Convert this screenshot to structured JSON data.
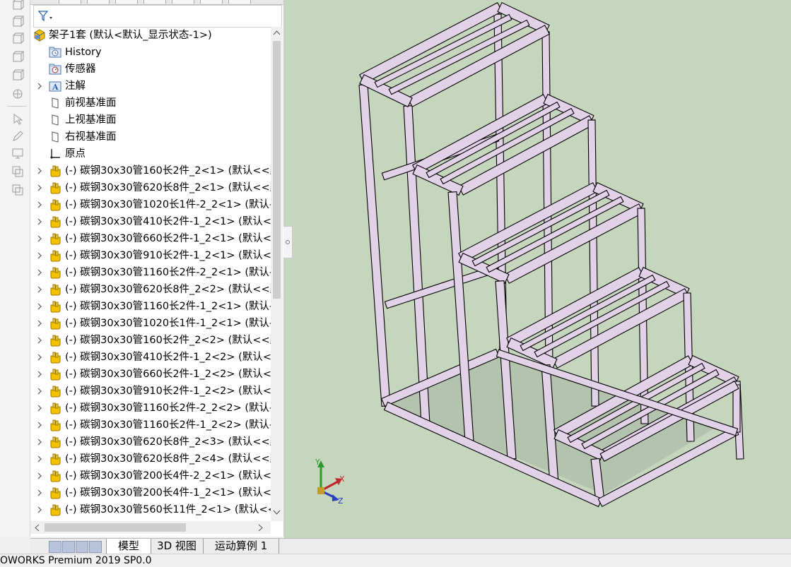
{
  "tree": {
    "root_label": "架子1套  (默认<默认_显示状态-1>)",
    "items": [
      {
        "label": "History",
        "icon": "history-folder-icon",
        "expandable": false
      },
      {
        "label": "传感器",
        "icon": "sensor-icon",
        "expandable": false
      },
      {
        "label": "注解",
        "icon": "annotation-icon",
        "expandable": true
      },
      {
        "label": "前视基准面",
        "icon": "plane-icon",
        "expandable": false
      },
      {
        "label": "上视基准面",
        "icon": "plane-icon",
        "expandable": false
      },
      {
        "label": "右视基准面",
        "icon": "plane-icon",
        "expandable": false
      },
      {
        "label": "原点",
        "icon": "origin-icon",
        "expandable": false
      },
      {
        "label": "(-) 碳钢30x30管160长2件_2<1> (默认<<默",
        "icon": "part-icon",
        "expandable": true
      },
      {
        "label": "(-) 碳钢30x30管620长8件_2<1> (默认<<默",
        "icon": "part-icon",
        "expandable": true
      },
      {
        "label": "(-) 碳钢30x30管1020长1件-2_2<1> (默认-",
        "icon": "part-icon",
        "expandable": true
      },
      {
        "label": "(-) 碳钢30x30管410长2件-1_2<1> (默认<",
        "icon": "part-icon",
        "expandable": true
      },
      {
        "label": "(-) 碳钢30x30管660长2件-1_2<1> (默认<",
        "icon": "part-icon",
        "expandable": true
      },
      {
        "label": "(-) 碳钢30x30管910长2件-1_2<1> (默认<",
        "icon": "part-icon",
        "expandable": true
      },
      {
        "label": "(-) 碳钢30x30管1160长2件-2_2<1> (默认-",
        "icon": "part-icon",
        "expandable": true
      },
      {
        "label": "(-) 碳钢30x30管620长8件_2<2> (默认<<默",
        "icon": "part-icon",
        "expandable": true
      },
      {
        "label": "(-) 碳钢30x30管1160长2件-1_2<1> (默认-",
        "icon": "part-icon",
        "expandable": true
      },
      {
        "label": "(-) 碳钢30x30管1020长1件-1_2<1> (默认-",
        "icon": "part-icon",
        "expandable": true
      },
      {
        "label": "(-) 碳钢30x30管160长2件_2<2> (默认<<默",
        "icon": "part-icon",
        "expandable": true
      },
      {
        "label": "(-) 碳钢30x30管410长2件-1_2<2> (默认<",
        "icon": "part-icon",
        "expandable": true
      },
      {
        "label": "(-) 碳钢30x30管660长2件-1_2<2> (默认<",
        "icon": "part-icon",
        "expandable": true
      },
      {
        "label": "(-) 碳钢30x30管910长2件-1_2<2> (默认<",
        "icon": "part-icon",
        "expandable": true
      },
      {
        "label": "(-) 碳钢30x30管1160长2件-2_2<2> (默认-",
        "icon": "part-icon",
        "expandable": true
      },
      {
        "label": "(-) 碳钢30x30管1160长2件-1_2<2> (默认-",
        "icon": "part-icon",
        "expandable": true
      },
      {
        "label": "(-) 碳钢30x30管620长8件_2<3> (默认<<默",
        "icon": "part-icon",
        "expandable": true
      },
      {
        "label": "(-) 碳钢30x30管620长8件_2<4> (默认<<默",
        "icon": "part-icon",
        "expandable": true
      },
      {
        "label": "(-) 碳钢30x30管200长4件-2_2<1> (默认<",
        "icon": "part-icon",
        "expandable": true
      },
      {
        "label": "(-) 碳钢30x30管200长4件-1_2<1> (默认<",
        "icon": "part-icon",
        "expandable": true
      },
      {
        "label": "(-) 碳钢30x30管560长11件_2<1> (默认<<",
        "icon": "part-icon",
        "expandable": true
      }
    ]
  },
  "triad": {
    "x": "X",
    "y": "Y",
    "z": "Z"
  },
  "bottom_tabs": [
    "模型",
    "3D 视图",
    "运动算例 1"
  ],
  "status_text": "OWORKS Premium 2019 SP0.0",
  "colors": {
    "viewport_bg": "#c6d6bd",
    "frame_face": "#e2d2e8",
    "frame_edge": "#000000",
    "part_icon": "#f2c200"
  }
}
